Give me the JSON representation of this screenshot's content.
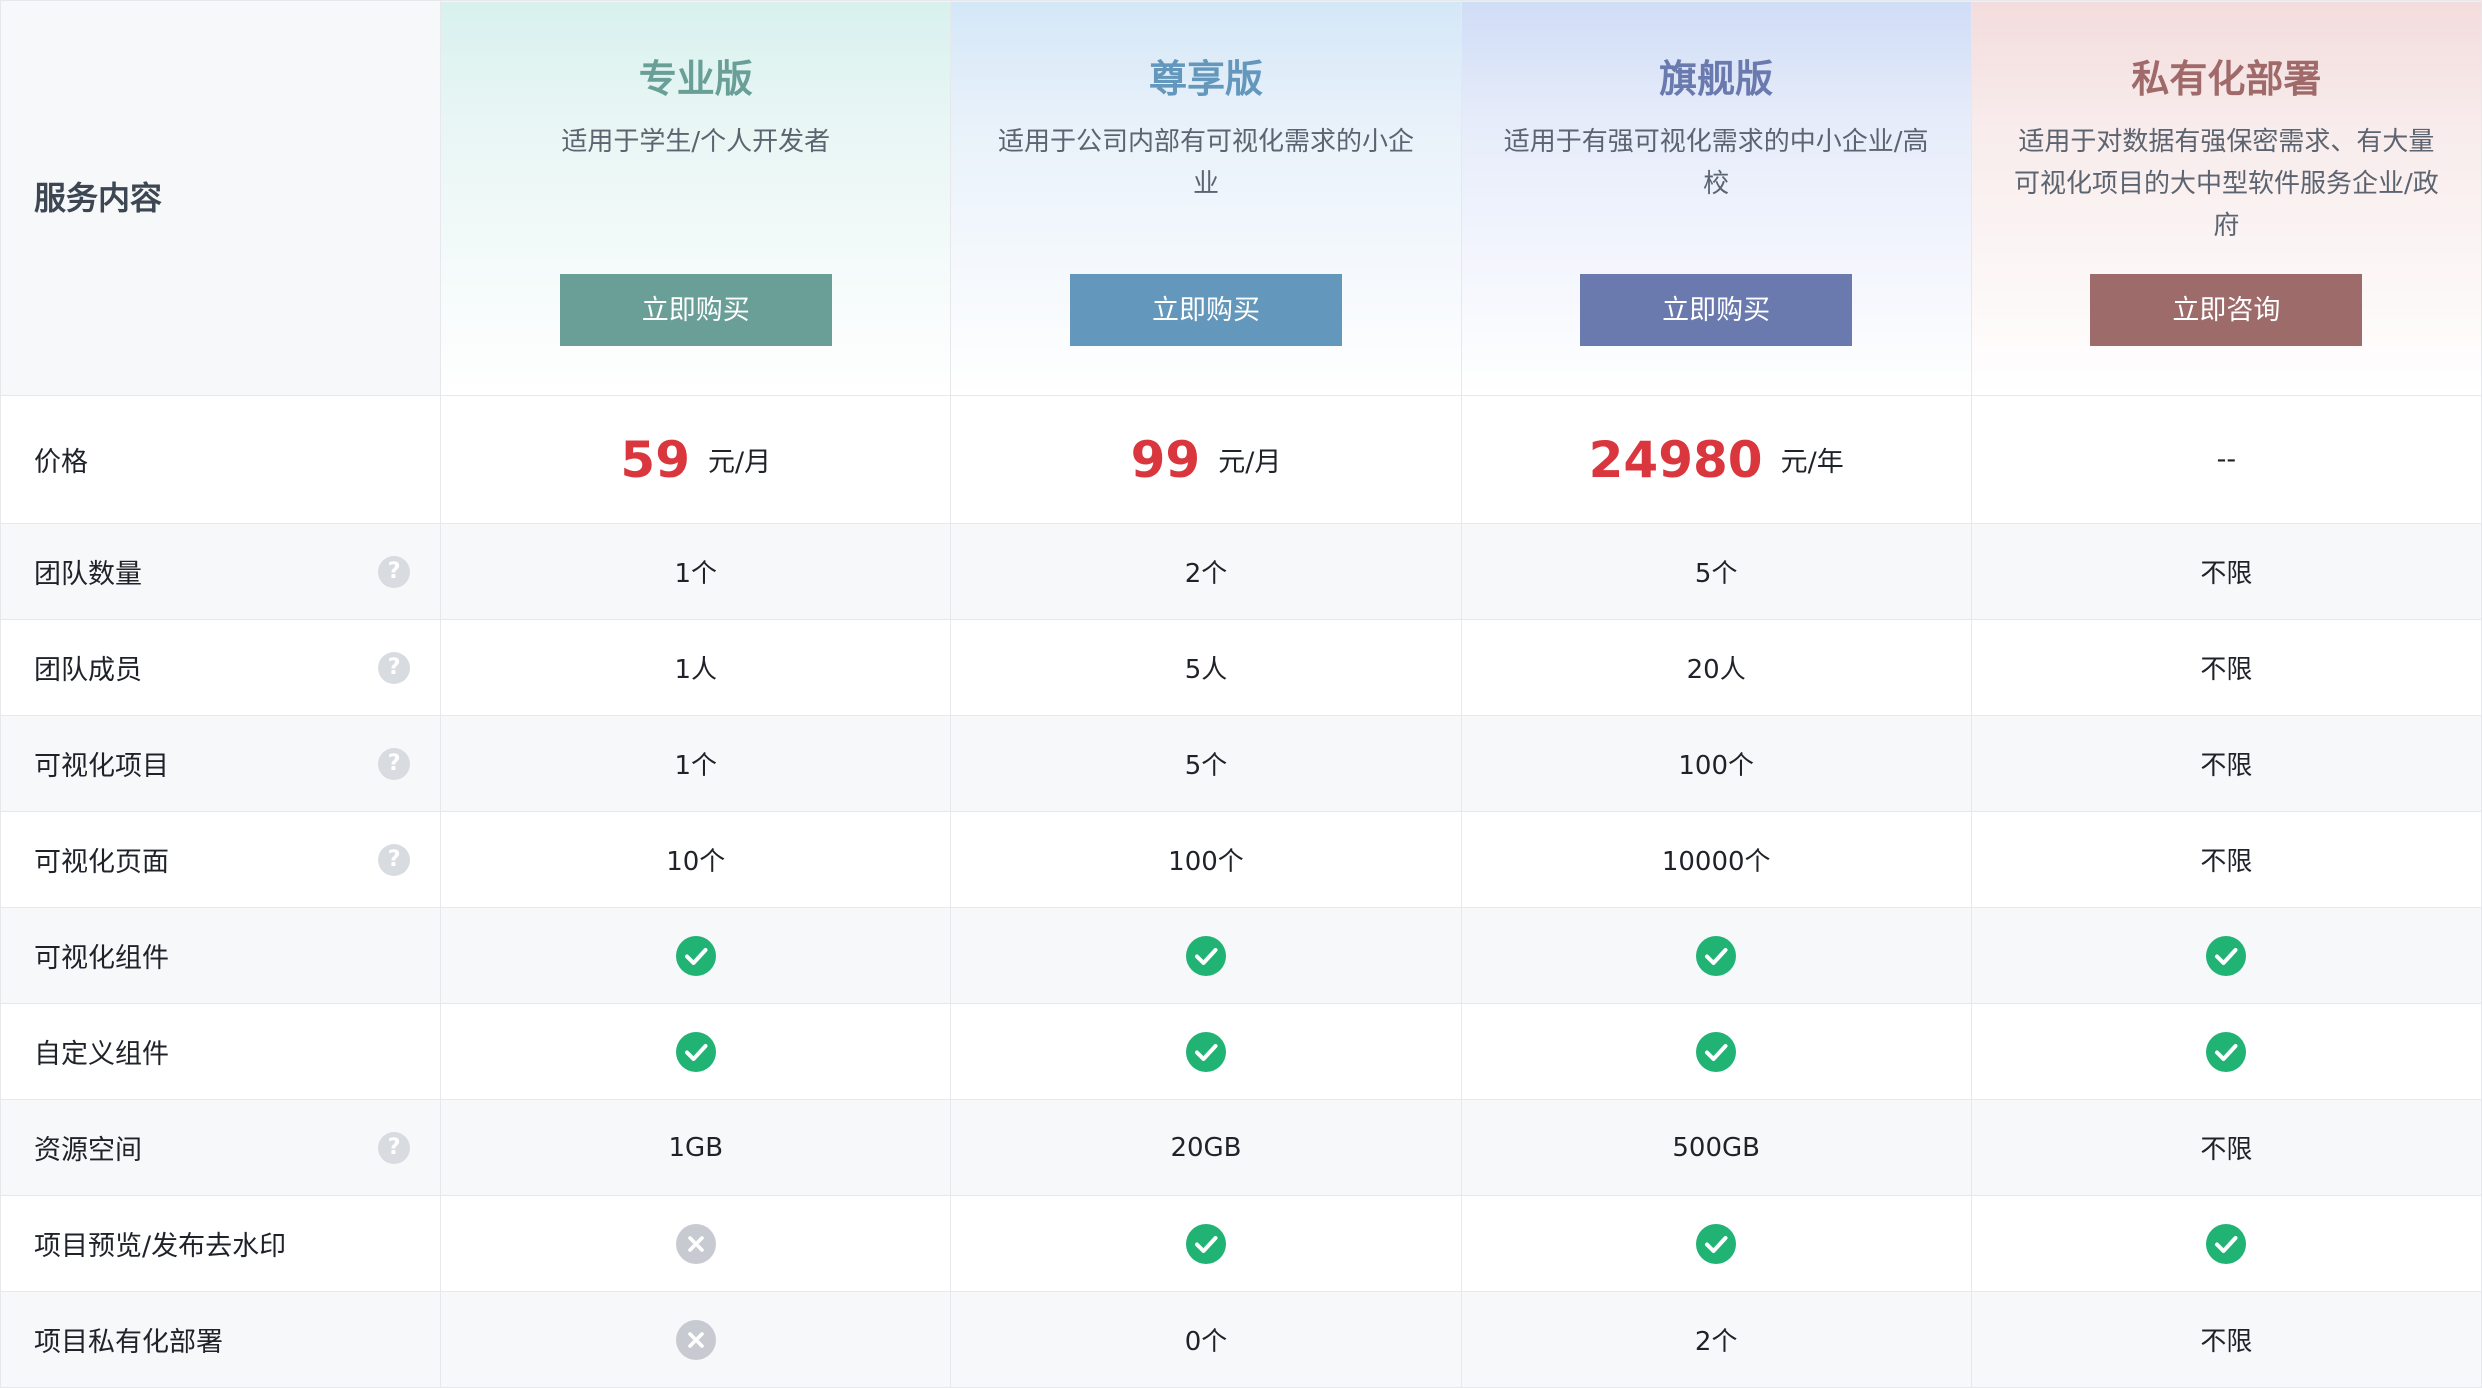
{
  "header": {
    "service_label": "服务内容"
  },
  "plans": [
    {
      "name": "专业版",
      "desc": "适用于学生/个人开发者",
      "button": "立即购买",
      "color": "#6a9f98",
      "name_color": "#6a9f98"
    },
    {
      "name": "尊享版",
      "desc": "适用于公司内部有可视化需求的小企业",
      "button": "立即购买",
      "color": "#6397bb",
      "name_color": "#6397bb"
    },
    {
      "name": "旗舰版",
      "desc": "适用于有强可视化需求的中小企业/高校",
      "button": "立即购买",
      "color": "#6b7aae",
      "name_color": "#6b7aae"
    },
    {
      "name": "私有化部署",
      "desc": "适用于对数据有强保密需求、有大量可视化项目的大中型软件服务企业/政府",
      "button": "立即咨询",
      "color": "#9e6b6b",
      "name_color": "#a06a6b"
    }
  ],
  "price": {
    "label": "价格",
    "values": [
      {
        "num": "59",
        "unit": "元/月"
      },
      {
        "num": "99",
        "unit": "元/月"
      },
      {
        "num": "24980",
        "unit": "元/年"
      },
      {
        "num": "",
        "unit": "--"
      }
    ]
  },
  "features": [
    {
      "label": "团队数量",
      "help": true,
      "values": [
        "1个",
        "2个",
        "5个",
        "不限"
      ]
    },
    {
      "label": "团队成员",
      "help": true,
      "values": [
        "1人",
        "5人",
        "20人",
        "不限"
      ]
    },
    {
      "label": "可视化项目",
      "help": true,
      "values": [
        "1个",
        "5个",
        "100个",
        "不限"
      ]
    },
    {
      "label": "可视化页面",
      "help": true,
      "values": [
        "10个",
        "100个",
        "10000个",
        "不限"
      ]
    },
    {
      "label": "可视化组件",
      "help": false,
      "values": [
        "check",
        "check",
        "check",
        "check"
      ]
    },
    {
      "label": "自定义组件",
      "help": false,
      "values": [
        "check",
        "check",
        "check",
        "check"
      ]
    },
    {
      "label": "资源空间",
      "help": true,
      "values": [
        "1GB",
        "20GB",
        "500GB",
        "不限"
      ]
    },
    {
      "label": "项目预览/发布去水印",
      "help": false,
      "values": [
        "cross",
        "check",
        "check",
        "check"
      ]
    },
    {
      "label": "项目私有化部署",
      "help": false,
      "values": [
        "cross",
        "0个",
        "2个",
        "不限"
      ]
    }
  ],
  "icons": {
    "help": "question-icon",
    "check": "check-circle-icon",
    "cross": "x-circle-icon",
    "help_glyph": "?"
  },
  "colors": {
    "price": "#d9363e",
    "check": "#21b374",
    "cross": "#c7cad1"
  }
}
